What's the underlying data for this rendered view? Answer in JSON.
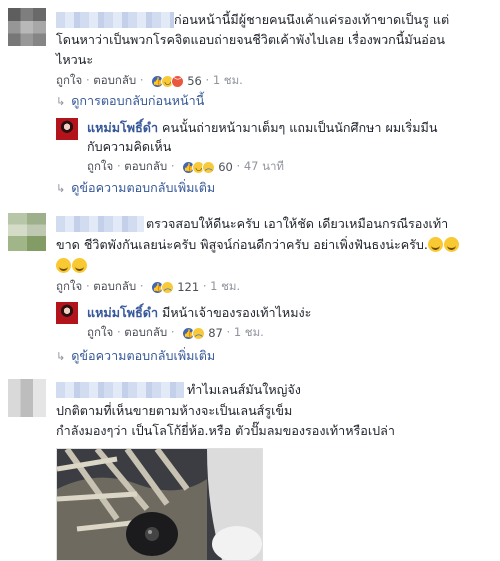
{
  "comments": [
    {
      "line1": "ก่อนหน้านี้มีผู้ชายคนนึงเค้าแค่รองเท้าขาดเป็นรู แต่",
      "line2": "โดนหาว่าเป็นพวกโรคจิตแอบถ่ายจนชีวิตเค้าพังไปเลย เรื่องพวกนี้มันอ่อน",
      "line3": "ไหวนะ",
      "like_label": "ถูกใจ",
      "reply_label": "ตอบกลับ",
      "reaction_count": "56",
      "time": "1 ชม.",
      "prev_replies_label": "ดูการตอบกลับก่อนหน้านี้",
      "reply": {
        "name": "แหม่มโพธิ์ดำ",
        "line1": "คนนั้นถ่ายหน้ามาเต็มๆ แถมเป็นนักศึกษา ผมเริ่มมีน",
        "line2": "กับความคิดเห็น",
        "like_label": "ถูกใจ",
        "reply_label": "ตอบกลับ",
        "reaction_count": "60",
        "time": "47 นาที"
      },
      "more_replies_label": "ดูข้อความตอบกลับเพิ่มเติม"
    },
    {
      "line1": "ตรวจสอบให้ดีนะครับ เอาให้ชัด เดียวเหมือนกรณีรองเท้า",
      "line2": "ขาด ชีวิตพังกันเลยน่ะครับ พิสูจน์ก่อนดีกว่าครับ อย่าเพิ่งฟันธงน่ะครับ.",
      "like_label": "ถูกใจ",
      "reply_label": "ตอบกลับ",
      "reaction_count": "121",
      "time": "1 ชม.",
      "reply": {
        "name": "แหม่มโพธิ์ดำ",
        "line1": "มีหน้าเจ้าของรองเท้าไหมง่ะ",
        "like_label": "ถูกใจ",
        "reply_label": "ตอบกลับ",
        "reaction_count": "87",
        "time": "1 ชม."
      },
      "more_replies_label": "ดูข้อความตอบกลับเพิ่มเติม"
    },
    {
      "line1": "ทำไมเลนส์มันใหญ่จัง",
      "line2": "ปกติตามที่เห็นขายตามห้างจะเป็นเลนส์รูเข็ม",
      "line3": "กำลังมองๆว่า เป็นโลโก้ยี่ห้อ.หรือ ตัวปั๊มลมของรองเท้าหรือเปล่า"
    }
  ],
  "separator": "·"
}
